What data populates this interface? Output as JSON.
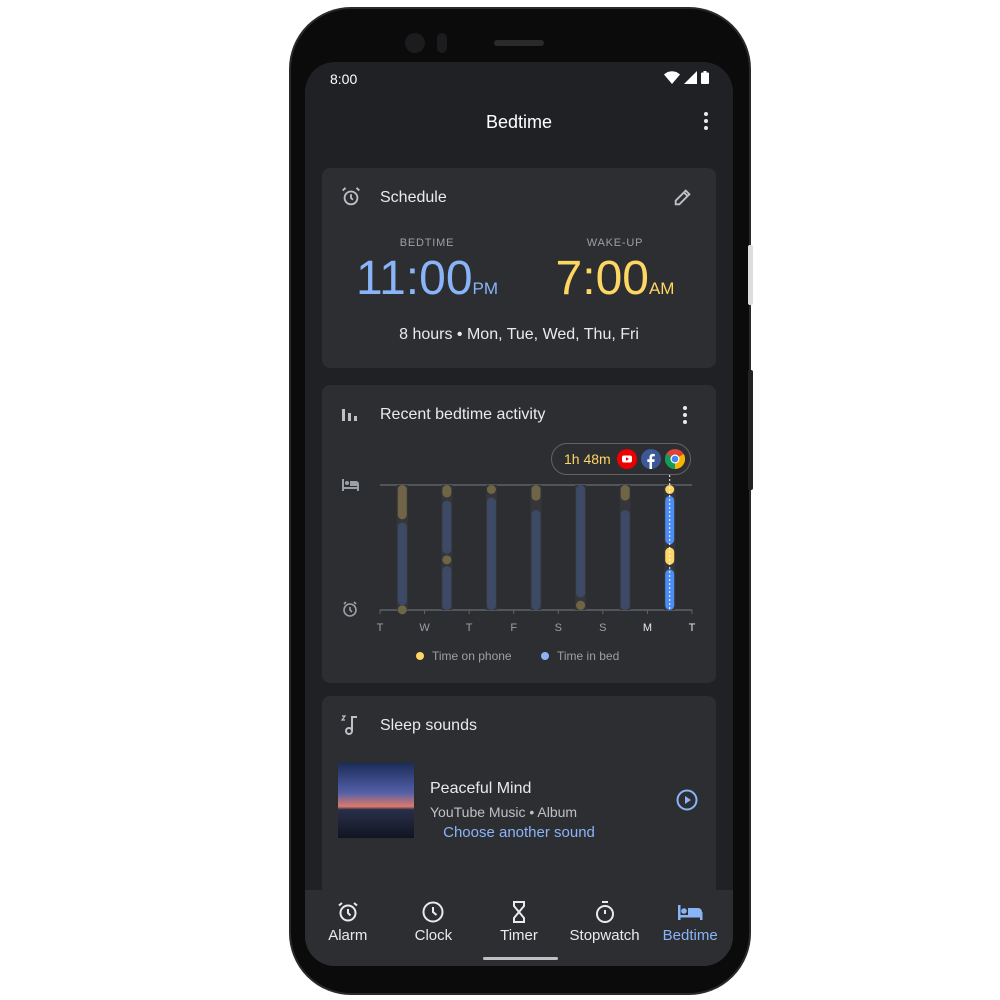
{
  "status_bar": {
    "time": "8:00"
  },
  "app_bar": {
    "title": "Bedtime"
  },
  "schedule": {
    "title": "Schedule",
    "bedtime_label": "BEDTIME",
    "bedtime_time": "11:00",
    "bedtime_ampm": "PM",
    "wake_label": "WAKE-UP",
    "wake_time": "7:00",
    "wake_ampm": "AM",
    "summary": "8 hours • Mon, Tue, Wed, Thu, Fri"
  },
  "activity": {
    "title": "Recent bedtime activity",
    "tooltip": "1h 48m",
    "tooltip_apps": [
      "youtube-icon",
      "facebook-icon",
      "chrome-icon"
    ]
  },
  "chart_data": {
    "type": "bar",
    "subtype": "timeline",
    "x_tick_labels": [
      "T",
      "W",
      "T",
      "F",
      "S",
      "S",
      "M",
      "T"
    ],
    "y_range_hours": [
      0,
      8
    ],
    "y_top": "bedtime (bed icon)",
    "y_bottom": "wake-up (alarm icon)",
    "legend": [
      {
        "name": "Time on phone",
        "color": "#fdd663"
      },
      {
        "name": "Time in bed",
        "color": "#8ab4f8"
      }
    ],
    "legend_placement": "bottom",
    "nights": [
      {
        "segments": [
          [
            "phone",
            0,
            2.2
          ],
          [
            "bed",
            2.4,
            7.7
          ],
          [
            "phone",
            7.7,
            8
          ]
        ]
      },
      {
        "segments": [
          [
            "phone",
            0,
            0.8
          ],
          [
            "bed",
            1.0,
            4.4
          ],
          [
            "phone",
            4.5,
            5.0
          ],
          [
            "bed",
            5.2,
            8
          ]
        ]
      },
      {
        "segments": [
          [
            "phone",
            0,
            0.5
          ],
          [
            "bed",
            0.8,
            8
          ]
        ]
      },
      {
        "segments": [
          [
            "phone",
            0,
            1.0
          ],
          [
            "bed",
            1.6,
            8
          ]
        ]
      },
      {
        "segments": [
          [
            "bed",
            0,
            7.2
          ],
          [
            "phone",
            7.4,
            8
          ]
        ]
      },
      {
        "segments": [
          [
            "phone",
            0,
            1.0
          ],
          [
            "bed",
            1.6,
            8
          ]
        ]
      },
      {
        "highlighted": true,
        "segments": [
          [
            "phone",
            0,
            0.4
          ],
          [
            "bed",
            0.7,
            3.8
          ],
          [
            "phone",
            4.0,
            5.1
          ],
          [
            "bed",
            5.4,
            8
          ]
        ]
      }
    ]
  },
  "sleep_sounds": {
    "title": "Sleep  sounds",
    "track": "Peaceful Mind",
    "subtitle": "YouTube Music • Album",
    "choose": "Choose another sound"
  },
  "nav": [
    {
      "label": "Alarm",
      "icon": "alarm-icon"
    },
    {
      "label": "Clock",
      "icon": "clock-icon"
    },
    {
      "label": "Timer",
      "icon": "timer-icon"
    },
    {
      "label": "Stopwatch",
      "icon": "stopwatch-icon"
    },
    {
      "label": "Bedtime",
      "icon": "bed-icon",
      "active": true
    }
  ],
  "colors": {
    "accent": "#8ab4f8",
    "bedtime": "#8ab4f8",
    "wake": "#fdd663",
    "background": "#202124",
    "card": "#2d2e31"
  }
}
